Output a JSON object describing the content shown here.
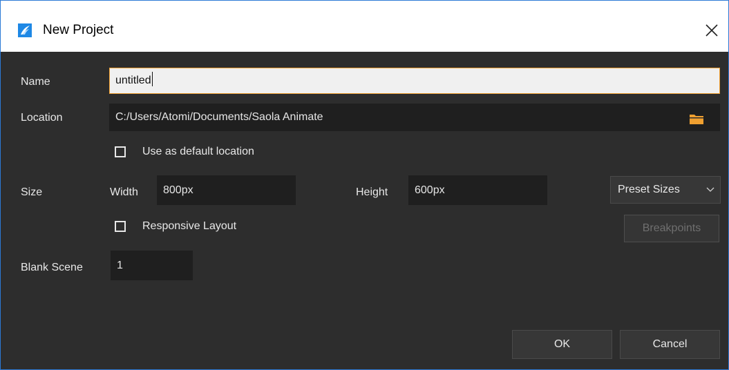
{
  "window": {
    "title": "New Project",
    "accent_color": "#f0a030"
  },
  "form": {
    "name": {
      "label": "Name",
      "value": "untitled"
    },
    "location": {
      "label": "Location",
      "value": "C:/Users/Atomi/Documents/Saola Animate",
      "folder_icon_color": "#f0a030"
    },
    "default_location": {
      "label": "Use as default location",
      "checked": false
    },
    "size": {
      "label": "Size",
      "width_label": "Width",
      "width_value": "800px",
      "height_label": "Height",
      "height_value": "600px",
      "preset_label": "Preset Sizes"
    },
    "responsive": {
      "label": "Responsive Layout",
      "checked": false
    },
    "breakpoints_label": "Breakpoints",
    "blank_scene": {
      "label": "Blank Scene",
      "value": "1"
    }
  },
  "buttons": {
    "ok_label": "OK",
    "cancel_label": "Cancel"
  }
}
